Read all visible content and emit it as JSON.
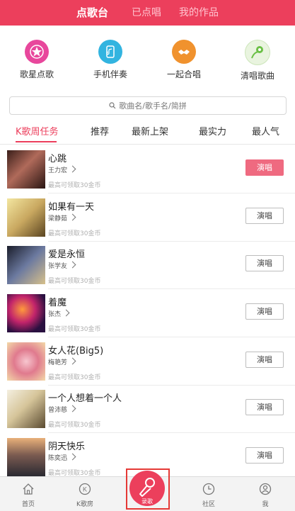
{
  "header": {
    "tabs": [
      {
        "label": "点歌台",
        "active": true
      },
      {
        "label": "已点唱",
        "active": false
      },
      {
        "label": "我的作品",
        "active": false
      }
    ]
  },
  "categories": [
    {
      "label": "歌星点歌",
      "icon": "star-icon",
      "color": "#e8479c"
    },
    {
      "label": "手机伴奏",
      "icon": "phone-icon",
      "color": "#32b4e0"
    },
    {
      "label": "一起合唱",
      "icon": "handshake-icon",
      "color": "#f0922e"
    },
    {
      "label": "清唱歌曲",
      "icon": "microphone-leaf-icon",
      "color": "#6bc046"
    }
  ],
  "search": {
    "placeholder": "歌曲名/歌手名/简拼"
  },
  "tabs": [
    {
      "label": "K歌周任务",
      "active": true
    },
    {
      "label": "推荐",
      "active": false
    },
    {
      "label": "最新上架",
      "active": false
    },
    {
      "label": "最实力",
      "active": false
    },
    {
      "label": "最人气",
      "active": false
    }
  ],
  "songs": [
    {
      "title": "心跳",
      "artist": "王力宏",
      "reward": "最高可领取30金币",
      "button": "演唱",
      "highlighted": true
    },
    {
      "title": "如果有一天",
      "artist": "梁静茹",
      "reward": "最高可领取30金币",
      "button": "演唱",
      "highlighted": false
    },
    {
      "title": "爱是永恒",
      "artist": "张学友",
      "reward": "最高可领取30金币",
      "button": "演唱",
      "highlighted": false
    },
    {
      "title": "着魔",
      "artist": "张杰",
      "reward": "最高可领取30金币",
      "button": "演唱",
      "highlighted": false
    },
    {
      "title": "女人花(Big5)",
      "artist": "梅艳芳",
      "reward": "最高可领取30金币",
      "button": "演唱",
      "highlighted": false
    },
    {
      "title": "一个人想着一个人",
      "artist": "曾沛慈",
      "reward": "最高可领取30金币",
      "button": "演唱",
      "highlighted": false
    },
    {
      "title": "阴天快乐",
      "artist": "陈奕迅",
      "reward": "最高可领取30金币",
      "button": "演唱",
      "highlighted": false
    }
  ],
  "bottom_nav": [
    {
      "label": "首页",
      "icon": "home-icon"
    },
    {
      "label": "K歌房",
      "icon": "k-room-icon"
    },
    {
      "label": "录歌",
      "icon": "microphone-icon"
    },
    {
      "label": "社区",
      "icon": "clock-icon"
    },
    {
      "label": "我",
      "icon": "user-icon"
    }
  ],
  "colors": {
    "accent": "#ec3f5c",
    "button_active": "#ef6a80"
  }
}
